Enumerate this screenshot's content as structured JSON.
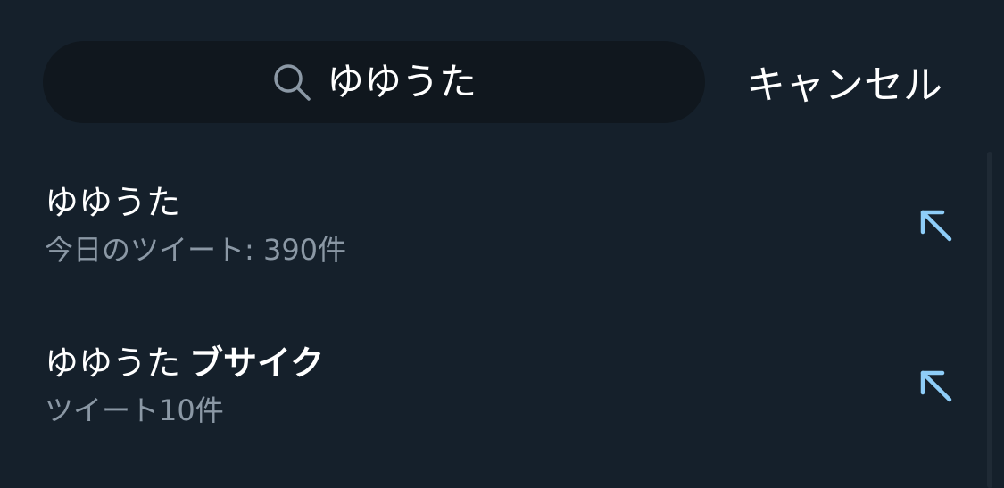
{
  "search": {
    "query": "ゆゆうた",
    "icon": "search-icon"
  },
  "header": {
    "cancel_label": "キャンセル"
  },
  "suggestions": [
    {
      "title": "ゆゆうた",
      "title_bold": "",
      "subtitle": "今日のツイート: 390件",
      "icon": "arrow-up-left-icon"
    },
    {
      "title": "ゆゆうた",
      "title_bold": "ブサイク",
      "subtitle": "ツイート10件",
      "icon": "arrow-up-left-icon"
    }
  ],
  "colors": {
    "background": "#15202b",
    "search_field": "#10171e",
    "accent": "#8ecdf8",
    "secondary_text": "#8b98a5"
  }
}
